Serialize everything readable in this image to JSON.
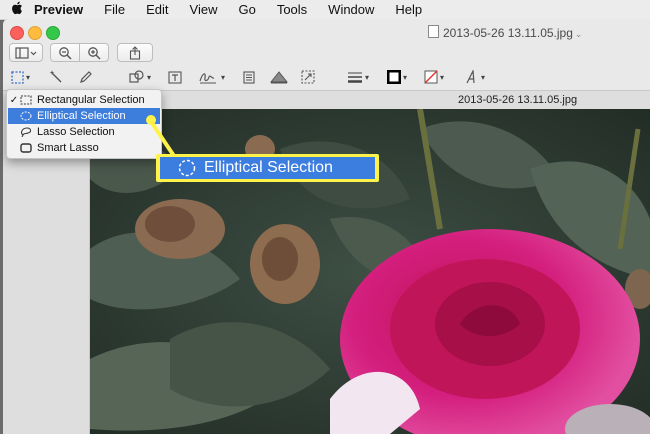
{
  "menubar": {
    "app_name": "Preview",
    "items": [
      "File",
      "Edit",
      "View",
      "Go",
      "Tools",
      "Window",
      "Help"
    ]
  },
  "window": {
    "title": "2013-05-26 13.11.05.jpg",
    "tab_title": "2013-05-26 13.11.05.jpg"
  },
  "dropdown": {
    "items": [
      {
        "label": "Rectangular Selection",
        "checked": true,
        "selected": false
      },
      {
        "label": "Elliptical Selection",
        "checked": false,
        "selected": true
      },
      {
        "label": "Lasso Selection",
        "checked": false,
        "selected": false
      },
      {
        "label": "Smart Lasso",
        "checked": false,
        "selected": false
      }
    ],
    "check_mark": "✓"
  },
  "callout": {
    "label": "Elliptical Selection"
  },
  "colors": {
    "selection_blue": "#3d7ddb",
    "callout_yellow": "#fff24a",
    "stroke_color": "#000000"
  }
}
